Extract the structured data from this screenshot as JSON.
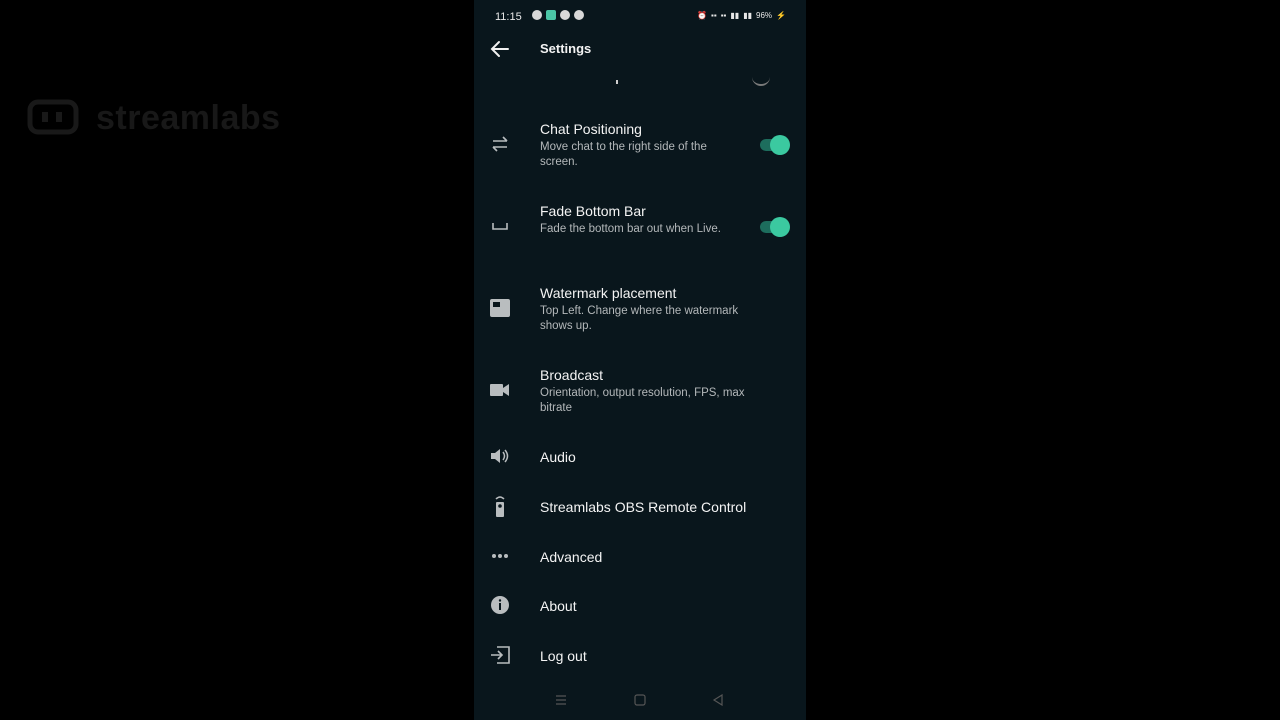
{
  "watermark": {
    "text": "streamlabs"
  },
  "status_bar": {
    "time": "11:15",
    "battery": "96%"
  },
  "app_bar": {
    "title": "Settings"
  },
  "settings": [
    {
      "label": "Chat Positioning",
      "description": "Move chat to the right side of the screen.",
      "icon": "swap-arrows-icon",
      "toggle": true
    },
    {
      "label": "Fade Bottom Bar",
      "description": "Fade the bottom bar out when Live.",
      "icon": "bottom-bar-icon",
      "toggle": true
    },
    {
      "label": "Watermark placement",
      "description": "Top Left. Change where the watermark shows up.",
      "icon": "watermark-icon"
    },
    {
      "label": "Broadcast",
      "description": "Orientation, output resolution, FPS, max bitrate",
      "icon": "videocam-icon"
    },
    {
      "label": "Audio",
      "icon": "speaker-icon"
    },
    {
      "label": "Streamlabs OBS Remote Control",
      "icon": "remote-icon"
    },
    {
      "label": "Advanced",
      "icon": "more-horizontal-icon"
    },
    {
      "label": "About",
      "icon": "info-icon"
    },
    {
      "label": "Log out",
      "icon": "logout-icon"
    }
  ],
  "colors": {
    "background": "#09161c",
    "accent": "#3bc9a0",
    "toggle_track": "#1d6d5d"
  }
}
